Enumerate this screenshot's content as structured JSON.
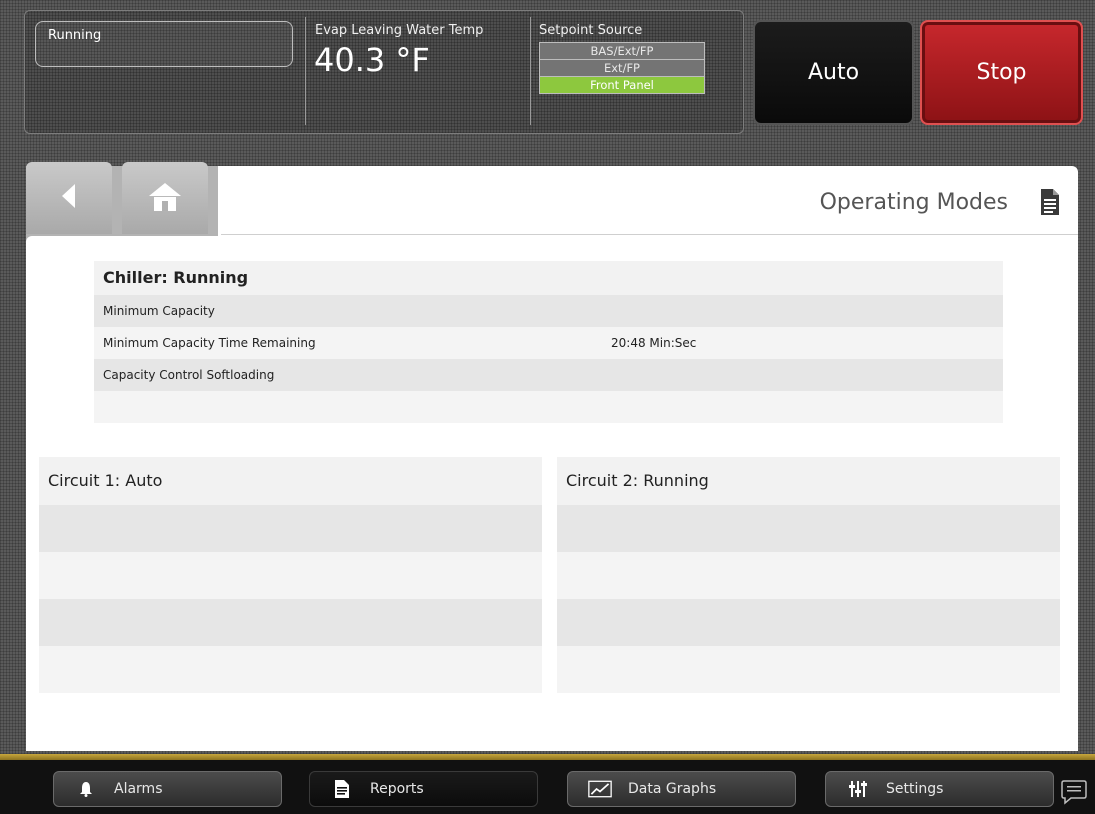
{
  "header": {
    "status": "Running",
    "evap_label": "Evap Leaving Water Temp",
    "evap_value": "40.3 °F",
    "setpoint_label": "Setpoint Source",
    "setpoint_options": [
      "BAS/Ext/FP",
      "Ext/FP",
      "Front Panel"
    ],
    "setpoint_active": "Front Panel",
    "auto_label": "Auto",
    "stop_label": "Stop"
  },
  "nav": {
    "back_icon": "back-arrow-icon",
    "home_icon": "home-icon"
  },
  "page": {
    "title": "Operating Modes",
    "title_icon": "document-icon"
  },
  "chiller": {
    "heading": "Chiller: Running",
    "rows": [
      {
        "label": "Minimum Capacity",
        "value": ""
      },
      {
        "label": "Minimum Capacity Time Remaining",
        "value": "20:48 Min:Sec"
      },
      {
        "label": "Capacity Control Softloading",
        "value": ""
      },
      {
        "label": "",
        "value": ""
      }
    ]
  },
  "circuits": [
    {
      "heading": "Circuit 1: Auto"
    },
    {
      "heading": "Circuit 2: Running"
    }
  ],
  "bottom_tabs": [
    {
      "label": "Alarms",
      "icon": "bell-icon"
    },
    {
      "label": "Reports",
      "icon": "report-icon"
    },
    {
      "label": "Data Graphs",
      "icon": "graph-icon"
    },
    {
      "label": "Settings",
      "icon": "sliders-icon"
    }
  ],
  "colors": {
    "stop": "#b5191f",
    "setpoint_active": "#8dc83e",
    "accent_strip": "#c7a63c"
  }
}
